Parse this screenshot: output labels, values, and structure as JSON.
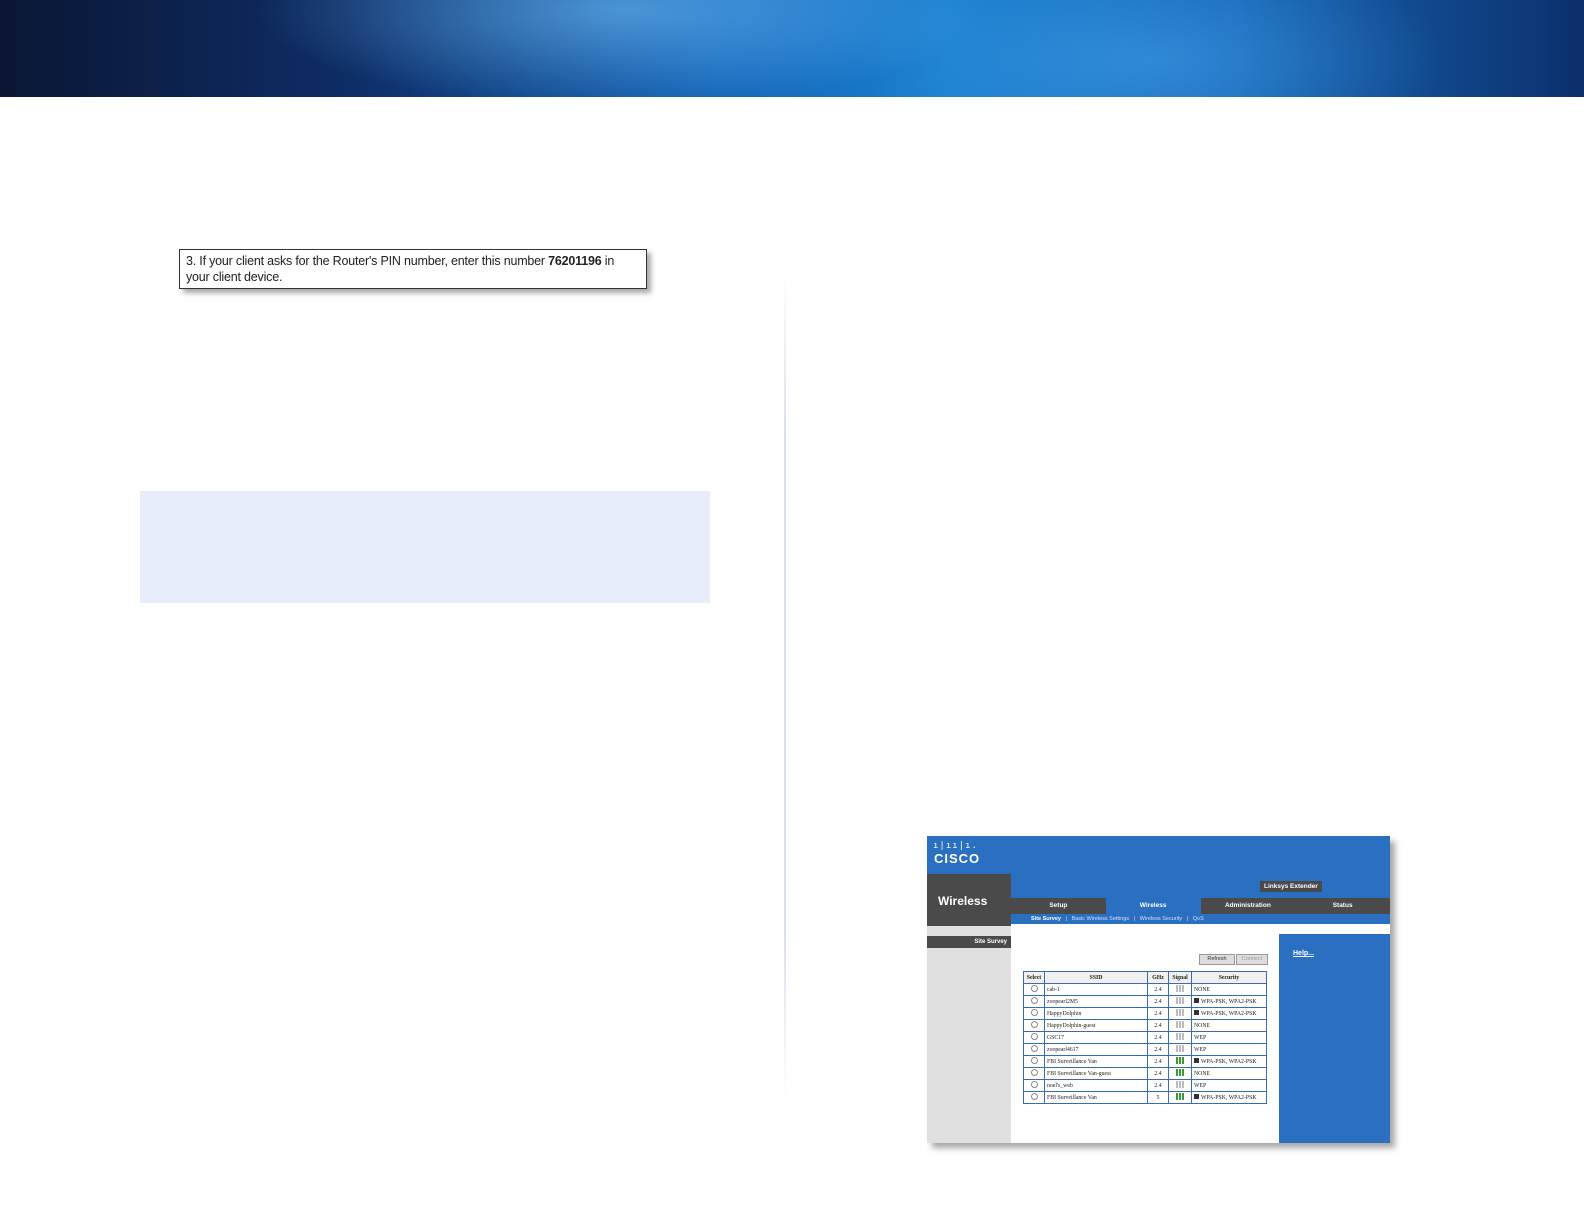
{
  "pin_callout": {
    "text_before": "3. If your client asks for the Router's PIN number, enter this number ",
    "pin": "76201196",
    "text_after": " in your client device."
  },
  "cisco_screenshot": {
    "brand": "CISCO",
    "brand_bars": "ı|ıı|ı.",
    "section_title": "Wireless",
    "product_name": "Linksys Extender",
    "tabs": [
      {
        "label": "Setup"
      },
      {
        "label": "Wireless"
      },
      {
        "label": "Administration"
      },
      {
        "label": "Status"
      }
    ],
    "active_tab": "Wireless",
    "subtabs": [
      "Site Survey",
      "Basic Wireless Settings",
      "Wireless Security",
      "QoS"
    ],
    "sidebar_item": "Site Survey",
    "help_link": "Help...",
    "buttons": [
      "Refresh",
      "Connect"
    ],
    "table": {
      "headers": [
        "Select",
        "SSID",
        "GHz",
        "Signal",
        "Security"
      ],
      "rows": [
        {
          "ssid": "cab-1",
          "ghz": "2.4",
          "signal": "weak",
          "security": "NONE",
          "wps": false
        },
        {
          "ssid": "zoopearl2M5",
          "ghz": "2.4",
          "signal": "weak",
          "security": "WPA-PSK, WPA2-PSK",
          "wps": true
        },
        {
          "ssid": "HappyDolphin",
          "ghz": "2.4",
          "signal": "weak",
          "security": "WPA-PSK, WPA2-PSK",
          "wps": true
        },
        {
          "ssid": "HappyDolphin-guest",
          "ghz": "2.4",
          "signal": "weak",
          "security": "NONE",
          "wps": false
        },
        {
          "ssid": "GSC17",
          "ghz": "2.4",
          "signal": "weak",
          "security": "WEP",
          "wps": false
        },
        {
          "ssid": "zoopearl4617",
          "ghz": "2.4",
          "signal": "weak",
          "security": "WEP",
          "wps": false
        },
        {
          "ssid": "FBI Surveillance Van",
          "ghz": "2.4",
          "signal": "strong",
          "security": "WPA-PSK, WPA2-PSK",
          "wps": true
        },
        {
          "ssid": "FBI Surveillance Van-guest",
          "ghz": "2.4",
          "signal": "strong",
          "security": "NONE",
          "wps": false
        },
        {
          "ssid": "noel's_web",
          "ghz": "2.4",
          "signal": "weak",
          "security": "WEP",
          "wps": false
        },
        {
          "ssid": "FBI Surveillance Van",
          "ghz": "5",
          "signal": "strong",
          "security": "WPA-PSK, WPA2-PSK",
          "wps": true
        }
      ]
    }
  }
}
